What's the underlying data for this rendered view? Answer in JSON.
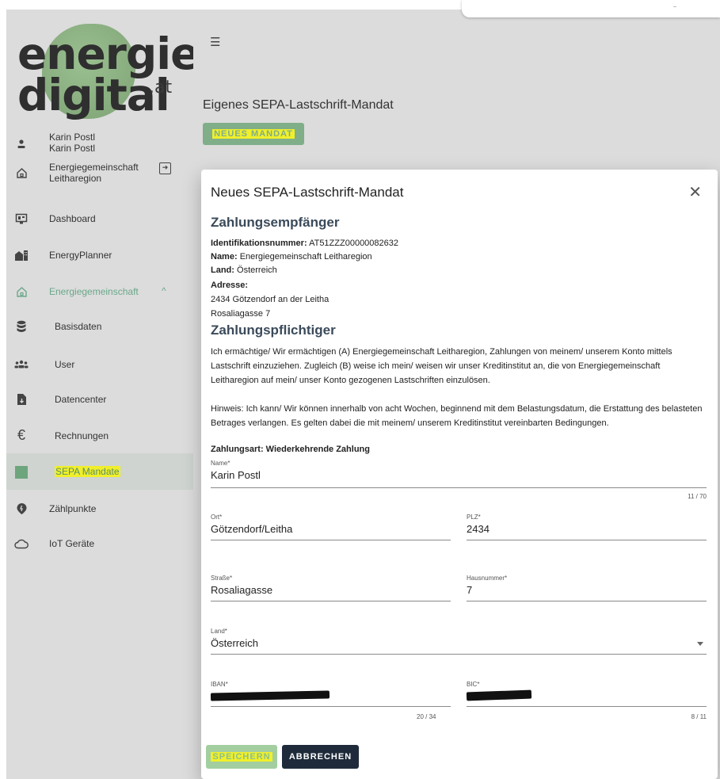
{
  "app": {
    "logo_line1": "energie",
    "logo_line2": "digital",
    "logo_suffix": ".at"
  },
  "sidebar": {
    "user_name": "Karin Postl",
    "user_sub": "Karin Postl",
    "community_line1": "Energiegemeinschaft",
    "community_line2": "Leitharegion",
    "items": [
      {
        "label": "Dashboard",
        "icon": "dashboard-icon"
      },
      {
        "label": "EnergyPlanner",
        "icon": "buildings-icon"
      },
      {
        "label": "Energiegemeinschaft",
        "icon": "home-icon"
      },
      {
        "label": "Basisdaten",
        "icon": "database-icon"
      },
      {
        "label": "User",
        "icon": "users-icon"
      },
      {
        "label": "Datencenter",
        "icon": "file-icon"
      },
      {
        "label": "Rechnungen",
        "icon": "euro-icon"
      },
      {
        "label": "SEPA Mandate",
        "icon": "square-icon"
      },
      {
        "label": "Zählpunkte",
        "icon": "meter-icon"
      },
      {
        "label": "IoT Geräte",
        "icon": "cloud-icon"
      }
    ]
  },
  "main": {
    "page_title": "Eigenes SEPA-Lastschrift-Mandat",
    "new_button": "NEUES MANDAT"
  },
  "modal": {
    "title": "Neues SEPA-Lastschrift-Mandat",
    "recipient_heading": "Zahlungsempfänger",
    "id_label": "Identifikationsnummer:",
    "id_value": "AT51ZZZ00000082632",
    "name_label": "Name:",
    "name_value": "Energiegemeinschaft Leitharegion",
    "country_label": "Land:",
    "country_value": "Österreich",
    "address_label": "Adresse:",
    "address_line1": "2434 Götzendorf an der Leitha",
    "address_line2": "Rosaliagasse 7",
    "payer_heading": "Zahlungspflichtiger",
    "mandate_text": "Ich ermächtige/ Wir ermächtigen (A) Energiegemeinschaft Leitharegion, Zahlungen von meinem/ unserem Konto mittels Lastschrift einzuziehen. Zugleich (B) weise ich mein/ weisen wir unser Kreditinstitut an, die von Energiegemeinschaft Leitharegion auf mein/ unser Konto gezogenen Lastschriften einzulösen.",
    "hint_text": "Hinweis: Ich kann/ Wir können innerhalb von acht Wochen, beginnend mit dem Belastungsdatum, die Erstattung des belasteten Betrages verlangen. Es gelten dabei die mit meinem/ unserem Kreditinstitut vereinbarten Bedingungen.",
    "payment_type": "Zahlungsart: Wiederkehrende Zahlung",
    "fields": {
      "name": {
        "label": "Name*",
        "value": "Karin Postl",
        "counter": "11 / 70"
      },
      "ort": {
        "label": "Ort*",
        "value": "Götzendorf/Leitha"
      },
      "plz": {
        "label": "PLZ*",
        "value": "2434"
      },
      "strasse": {
        "label": "Straße*",
        "value": "Rosaliagasse"
      },
      "hausnummer": {
        "label": "Hausnummer*",
        "value": "7"
      },
      "land": {
        "label": "Land*",
        "value": "Österreich"
      },
      "iban": {
        "label": "IBAN*",
        "counter": "20 / 34"
      },
      "bic": {
        "label": "BIC*",
        "counter": "8 / 11"
      }
    },
    "save_button": "SPEICHERN",
    "cancel_button": "ABBRECHEN"
  }
}
